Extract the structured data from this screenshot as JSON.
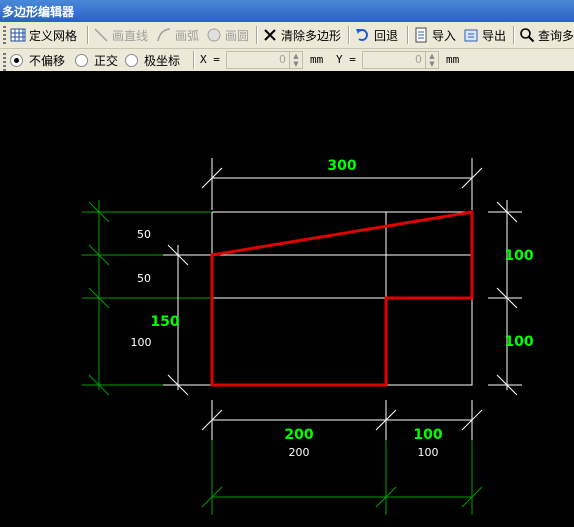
{
  "window": {
    "title": "多边形编辑器"
  },
  "toolbar": {
    "items": [
      {
        "label": "定义网格",
        "icon": "grid-icon",
        "enabled": true
      },
      {
        "label": "画直线",
        "icon": "line-icon",
        "enabled": false
      },
      {
        "label": "画弧",
        "icon": "arc-icon",
        "enabled": false
      },
      {
        "label": "画圆",
        "icon": "circle-icon",
        "enabled": false
      },
      {
        "label": "清除多边形",
        "icon": "clear-icon",
        "enabled": true
      },
      {
        "label": "回退",
        "icon": "undo-icon",
        "enabled": true
      },
      {
        "label": "导入",
        "icon": "import-icon",
        "enabled": true
      },
      {
        "label": "导出",
        "icon": "export-icon",
        "enabled": true
      },
      {
        "label": "查询多",
        "icon": "search-icon",
        "enabled": true
      }
    ]
  },
  "options": {
    "modes": [
      {
        "label": "不偏移",
        "selected": true
      },
      {
        "label": "正交",
        "selected": false
      },
      {
        "label": "极坐标",
        "selected": false
      }
    ],
    "x_label": "X =",
    "x_value": "0",
    "x_unit": "mm",
    "y_label": "Y =",
    "y_value": "0",
    "y_unit": "mm"
  },
  "drawing": {
    "colors": {
      "polygon": "#e00000",
      "grid": "#ffffff",
      "dimension_text": "#00ff00",
      "dimension_line": "#00a000"
    },
    "top_dim": "300",
    "bottom_dims_green": [
      "200",
      "100"
    ],
    "bottom_dims_white": [
      "200",
      "100"
    ],
    "right_dims": [
      "100",
      "100"
    ],
    "left_inner_green": "150",
    "left_inner_white": "100",
    "left_outer_white": [
      "50",
      "50"
    ]
  }
}
